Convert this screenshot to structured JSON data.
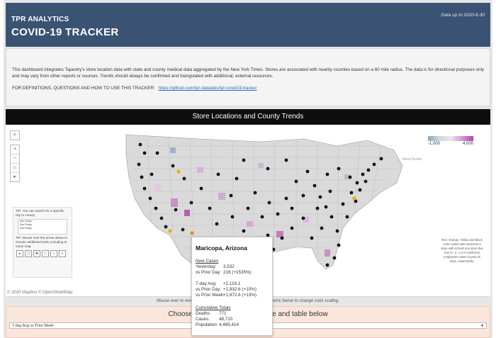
{
  "header": {
    "brand": "TPR ANALYTICS",
    "title": "COVID-19 TRACKER",
    "date_note": "Data up to 2020-6-30"
  },
  "intro": {
    "description": "This dashboard integrates Tapestry's store location data with state and county medical data aggregated by the New York Times. Stores are associated with nearby counties based on a 60 mile radius. The data is for directional purposes only and may vary from other reports or sources. Trends should always be confirmed and triangulated with additional, external resources.",
    "defs_label": "FOR DEFINITIONS, QUESTIONS AND HOW TO USE THIS TRACKER:",
    "defs_link": "https://github.com/tpr-datalabs/tpr-covid19-tracker"
  },
  "map": {
    "heading": "Store Locations and County Trends",
    "legend_min": "-1,000",
    "legend_max": "4,000",
    "attribution": "© 2020 Mapbox © OpenStreetMap",
    "tip_search": "TIP: You can search for a specific city or county",
    "tip_search_values": [
      "San Diego",
      "San Diego",
      "San Diego"
    ],
    "tip_hover": "TIP: Mouse over the arrow above to choose additional tools, including to move map",
    "note": "Red, Orange, Yellow and Black color-coded dots represent a store with at least one store that has 3+, 2, 1 or 0 confirmed employees cases in past 15 days, respectively.",
    "footer_text": "Mouse over to reveal store or county information. Choose a metric below to change color scaling.",
    "tool_icons": [
      "search-icon",
      "zoom-in-icon",
      "zoom-out-icon",
      "home-icon",
      "play-icon"
    ]
  },
  "popup": {
    "title": "Maricopa, Arizona",
    "new_cases_label": "New Cases",
    "yesterday_label": "Yesterday:",
    "yesterday_value": "3,532",
    "prior_day_label": "vs Prior Day:",
    "prior_day_value": "216 (+1535%)",
    "avg_label": "7-day Avg:",
    "avg_value": "+2,118.1",
    "avg_prior_day_label": "vs Prior Day:",
    "avg_prior_day_value": "+1,932.6 (+10%)",
    "avg_prior_week_label": "vs Prior Week:",
    "avg_prior_week_value": "+1,872.6 (+13%)",
    "cumulative_label": "Cumulative Totals",
    "deaths_label": "Deaths:",
    "deaths_value": "771",
    "cases_label": "Cases:",
    "cases_value": "48,710",
    "population_label": "Population:",
    "population_value": "4,485,414"
  },
  "metric": {
    "prompt": "Choose metric to color map above and table below",
    "selected": "7-day Avg vs Prior Week"
  }
}
